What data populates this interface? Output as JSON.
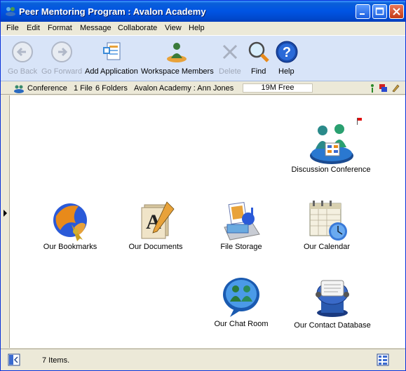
{
  "window": {
    "title": "Peer Mentoring Program : Avalon Academy"
  },
  "menu": [
    "File",
    "Edit",
    "Format",
    "Message",
    "Collaborate",
    "View",
    "Help"
  ],
  "toolbar": {
    "go_back": "Go Back",
    "go_forward": "Go Forward",
    "add_application": "Add Application",
    "workspace_members": "Workspace Members",
    "delete": "Delete",
    "find": "Find",
    "help": "Help"
  },
  "location": {
    "name": "Conference",
    "files": "1 File",
    "folders": "6 Folders",
    "path": "Avalon Academy : Ann Jones",
    "free": "19M Free"
  },
  "items": {
    "discussion_conference": "Discussion Conference",
    "our_bookmarks": "Our Bookmarks",
    "our_documents": "Our Documents",
    "file_storage": "File Storage",
    "our_calendar": "Our Calendar",
    "our_chat_room": "Our Chat Room",
    "our_contact_database": "Our Contact Database"
  },
  "status": {
    "count": "7 Items."
  },
  "colors": {
    "title_bar": "#0054e3",
    "toolbar_bg": "#d8e4f8",
    "window_bg": "#ece9d8"
  }
}
